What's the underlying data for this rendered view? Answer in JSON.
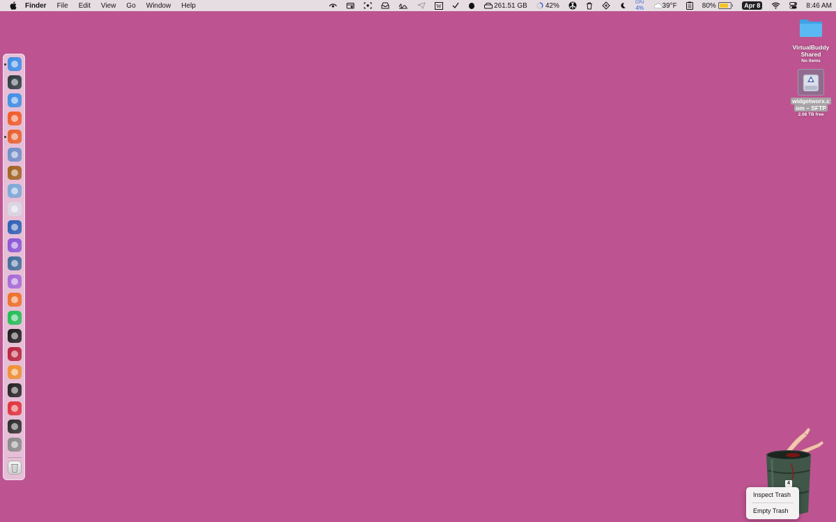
{
  "menubar": {
    "menus": [
      "Finder",
      "File",
      "Edit",
      "View",
      "Go",
      "Window",
      "Help"
    ],
    "status": {
      "disk": "261.51 GB",
      "progress": "42%",
      "cpu_label": "CPU",
      "cpu_value": "4%",
      "weather": "39°F",
      "battery": "80%",
      "battery_level": 0.8,
      "date": "Apr 8",
      "time": "8:46 AM"
    }
  },
  "dock": {
    "apps": [
      {
        "name": "finder-icon",
        "color": "#3b8de8",
        "running": true
      },
      {
        "name": "xcode-instruments-icon",
        "color": "#2b3a3f",
        "running": false
      },
      {
        "name": "xcode-tools-icon",
        "color": "#3c8ee6",
        "running": false
      },
      {
        "name": "brave-icon",
        "color": "#f15a29",
        "running": false
      },
      {
        "name": "firefox-icon",
        "color": "#e8602c",
        "running": true
      },
      {
        "name": "window-manager-icon",
        "color": "#6e8fc9",
        "running": false
      },
      {
        "name": "acorn-icon",
        "color": "#a0621f",
        "running": false
      },
      {
        "name": "preview-icon",
        "color": "#7aa9d8",
        "running": false
      },
      {
        "name": "bbedit-icon",
        "color": "#d8d8e4",
        "running": false
      },
      {
        "name": "word-icon",
        "color": "#2b5fb5",
        "running": false
      },
      {
        "name": "nova-icon",
        "color": "#8a55d6",
        "running": false
      },
      {
        "name": "infuse-icon",
        "color": "#3d6e99",
        "running": false
      },
      {
        "name": "downie-icon",
        "color": "#a56ad8",
        "running": false
      },
      {
        "name": "audio-app-icon",
        "color": "#ef6f25",
        "running": false
      },
      {
        "name": "spotify-icon",
        "color": "#1fbf54",
        "running": false
      },
      {
        "name": "terminal-icon",
        "color": "#1c1c1c",
        "running": false
      },
      {
        "name": "photo-booth-icon",
        "color": "#b8213a",
        "running": false
      },
      {
        "name": "beta-app-icon",
        "color": "#f0902f",
        "running": false
      },
      {
        "name": "layers-app-icon",
        "color": "#222222",
        "running": false
      },
      {
        "name": "opera-icon",
        "color": "#e0323b",
        "running": false
      },
      {
        "name": "activity-monitor-icon",
        "color": "#2b2b2b",
        "running": false
      },
      {
        "name": "system-settings-icon",
        "color": "#8a8a8a",
        "running": false
      }
    ],
    "trash": "trash-icon"
  },
  "desktop": {
    "folder": {
      "label_line1": "VirtualBuddy",
      "label_line2": "Shared",
      "sub": "No items"
    },
    "volume": {
      "label_line1": "widgetworx.c",
      "label_line2": "om – SFTP",
      "sub": "2.08 TB free"
    },
    "trash_count": "4"
  },
  "context_menu": {
    "items": [
      "Inspect Trash",
      "Empty Trash"
    ]
  },
  "colors": {
    "desktop": "#bd5491",
    "menubar": "#e6dde3"
  }
}
